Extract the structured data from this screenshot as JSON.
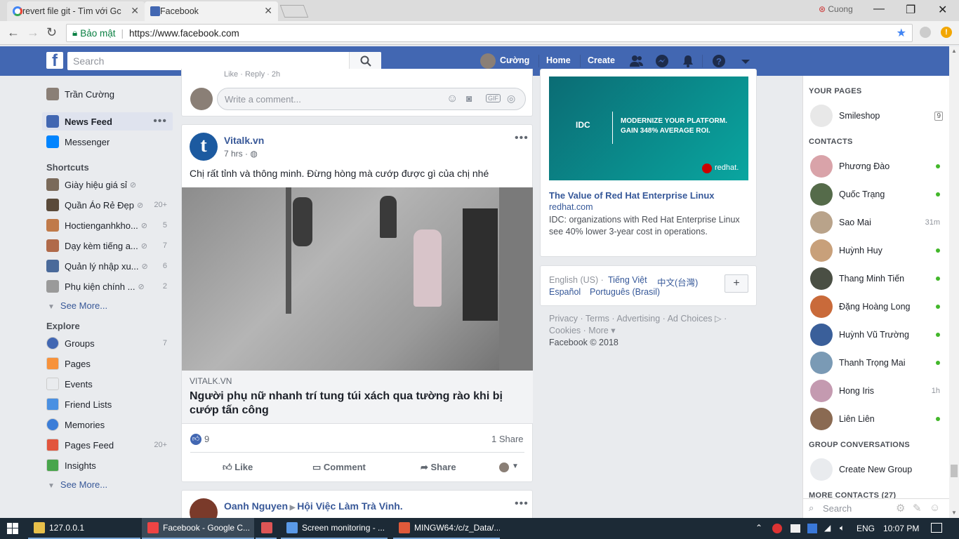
{
  "browser": {
    "tabs": [
      {
        "title": "revert file git - Tìm với Gc",
        "icon": "google-icon"
      },
      {
        "title": "Facebook",
        "icon": "facebook-icon"
      }
    ],
    "profile_name": "Cuong",
    "security_label": "Bảo mật",
    "url": "https://www.facebook.com"
  },
  "fb": {
    "search_placeholder": "Search",
    "user_name": "Cường",
    "nav": {
      "home": "Home",
      "create": "Create"
    }
  },
  "left": {
    "profile": "Trần Cường",
    "news_feed": "News Feed",
    "messenger": "Messenger",
    "shortcuts_title": "Shortcuts",
    "shortcuts": [
      {
        "label": "Giày hiệu giá sỉ",
        "count": ""
      },
      {
        "label": "Quần Áo Rẻ Đẹp",
        "count": "20+"
      },
      {
        "label": "Hoctienganhkho...",
        "count": "5"
      },
      {
        "label": "Dạy kèm tiếng a...",
        "count": "7"
      },
      {
        "label": "Quản lý nhập xu...",
        "count": "6"
      },
      {
        "label": "Phụ kiện chính ...",
        "count": "2"
      }
    ],
    "see_more_1": "See More...",
    "explore_title": "Explore",
    "explore": [
      {
        "label": "Groups",
        "count": "7",
        "color": "#4267b2"
      },
      {
        "label": "Pages",
        "count": "",
        "color": "#f7923b"
      },
      {
        "label": "Events",
        "count": "",
        "color": "#e9ebee"
      },
      {
        "label": "Friend Lists",
        "count": "",
        "color": "#4a90e2"
      },
      {
        "label": "Memories",
        "count": "",
        "color": "#3b7dd8"
      },
      {
        "label": "Pages Feed",
        "count": "20+",
        "color": "#e2553d"
      },
      {
        "label": "Insights",
        "count": "",
        "color": "#48a54b"
      }
    ],
    "see_more_2": "See More..."
  },
  "feed": {
    "comment_placeholder": "Write a comment...",
    "prev_footer": "Like · Reply · 2h",
    "post": {
      "author": "Vitalk.vn",
      "time": "7 hrs",
      "text": "Chị rất tỉnh và thông minh. Đừng hòng mà cướp được gì của chị nhé",
      "source": "VITALK.VN",
      "headline": "Người phụ nữ nhanh trí tung túi xách qua tường rào khi bị cướp tấn công",
      "likes": "9",
      "shares": "1 Share",
      "actions": {
        "like": "Like",
        "comment": "Comment",
        "share": "Share"
      }
    },
    "next_post": {
      "author": "Oanh Nguyen",
      "group": "Hội Việc Làm Trà Vinh."
    }
  },
  "ad": {
    "banner_line1": "MODERNIZE YOUR PLATFORM.",
    "banner_line2": "GAIN 348% AVERAGE ROI.",
    "banner_brand": "IDC",
    "banner_redhat": "redhat.",
    "title": "The Value of Red Hat Enterprise Linux",
    "domain": "redhat.com",
    "desc": "IDC: organizations with Red Hat Enterprise Linux see 40% lower 3-year cost in operations."
  },
  "languages": {
    "current": "English (US) ·",
    "l1": "Tiếng Việt",
    "l2": "中文(台灣)",
    "l3": "Español",
    "l4": "Português (Brasil)",
    "add": "+"
  },
  "footer": {
    "privacy": "Privacy",
    "terms": "Terms",
    "advertising": "Advertising",
    "adchoices": "Ad Choices",
    "cookies": "Cookies",
    "more": "More",
    "copyright": "Facebook © 2018"
  },
  "chat": {
    "your_pages": "YOUR PAGES",
    "page_name": "Smileshop",
    "page_badge": "9",
    "contacts_title": "CONTACTS",
    "contacts": [
      {
        "name": "Phương Đào",
        "status": "online",
        "color": "#d9a3a9"
      },
      {
        "name": "Quốc Trạng",
        "status": "online",
        "color": "#556b4a"
      },
      {
        "name": "Sao Mai",
        "status": "31m",
        "color": "#b9a38a"
      },
      {
        "name": "Huỳnh Huy",
        "status": "online",
        "color": "#c8a07a"
      },
      {
        "name": "Thang Minh Tiến",
        "status": "online",
        "color": "#4a4f44"
      },
      {
        "name": "Đặng Hoàng Long",
        "status": "online",
        "color": "#c96a3a"
      },
      {
        "name": "Huỳnh Vũ Trường",
        "status": "online",
        "color": "#3a5f9a"
      },
      {
        "name": "Thanh Trọng Mai",
        "status": "online",
        "color": "#7a9ab5"
      },
      {
        "name": "Hong Iris",
        "status": "1h",
        "color": "#c49ab0"
      },
      {
        "name": "Liên Liên",
        "status": "online",
        "color": "#8a6a52"
      }
    ],
    "group_conv_title": "GROUP CONVERSATIONS",
    "create_group": "Create New Group",
    "more_contacts": "MORE CONTACTS (27)",
    "search_placeholder": "Search"
  },
  "taskbar": {
    "items": [
      {
        "label": "127.0.0.1",
        "icon": "folder-icon"
      },
      {
        "label": "Facebook - Google C...",
        "icon": "chrome-icon"
      },
      {
        "label": "",
        "icon": "app-icon"
      },
      {
        "label": "Screen monitoring - ...",
        "icon": "cube-icon"
      },
      {
        "label": "MINGW64:/c/z_Data/...",
        "icon": "git-icon"
      }
    ],
    "lang": "ENG",
    "time": "10:07 PM"
  }
}
